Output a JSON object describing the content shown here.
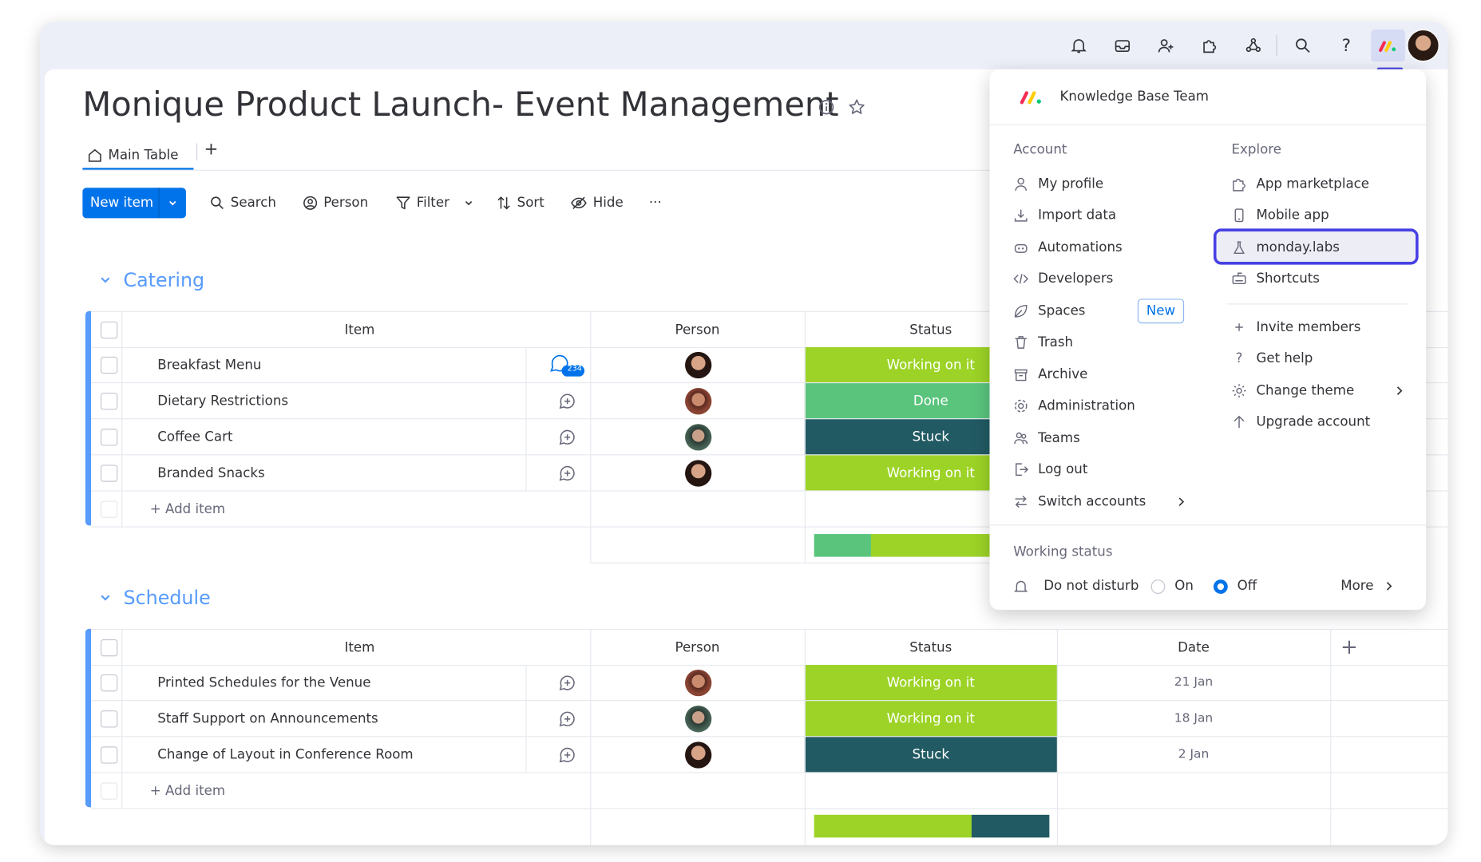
{
  "board": {
    "title": "Monique Product Launch- Event Management",
    "tabs": [
      {
        "label": "Main Table"
      }
    ],
    "add_tab": "+"
  },
  "toolbar": {
    "new_item": "New item",
    "search": "Search",
    "person": "Person",
    "filter": "Filter",
    "sort": "Sort",
    "hide": "Hide",
    "more": "···"
  },
  "columns": {
    "item": "Item",
    "person": "Person",
    "status": "Status",
    "date": "Date",
    "add": "+"
  },
  "groups": [
    {
      "name": "Catering",
      "color": "#579bfc",
      "rows": [
        {
          "item": "Breakfast Menu",
          "updates": "234",
          "status": "Working on it",
          "status_color": "#9cd326"
        },
        {
          "item": "Dietary Restrictions",
          "status": "Done",
          "status_color": "#5ac47d"
        },
        {
          "item": "Coffee Cart",
          "status": "Stuck",
          "status_color": "#225a63"
        },
        {
          "item": "Branded Snacks",
          "status": "Working on it",
          "status_color": "#9cd326"
        }
      ],
      "add_item": "+ Add item"
    },
    {
      "name": "Schedule",
      "color": "#579bfc",
      "rows": [
        {
          "item": "Printed Schedules for the Venue",
          "status": "Working on it",
          "status_color": "#9cd326",
          "date": "21 Jan"
        },
        {
          "item": "Staff Support on Announcements",
          "status": "Working on it",
          "status_color": "#9cd326",
          "date": "18 Jan"
        },
        {
          "item": "Change of Layout in Conference Room",
          "status": "Stuck",
          "status_color": "#225a63",
          "date": "2 Jan"
        }
      ],
      "add_item": "+ Add item"
    }
  ],
  "menu": {
    "account_name": "Knowledge Base Team",
    "account": {
      "title": "Account",
      "items": [
        "My profile",
        "Import data",
        "Automations",
        "Developers",
        "Spaces",
        "Trash",
        "Archive",
        "Administration",
        "Teams",
        "Log out",
        "Switch accounts"
      ],
      "new_badge": "New"
    },
    "explore": {
      "title": "Explore",
      "items": [
        "App marketplace",
        "Mobile app",
        "monday.labs",
        "Shortcuts"
      ],
      "secondary": [
        "Invite members",
        "Get help",
        "Change theme",
        "Upgrade account"
      ],
      "highlighted": "monday.labs"
    },
    "working_status": {
      "title": "Working status",
      "label": "Do not disturb",
      "on": "On",
      "off": "Off",
      "selected": "Off",
      "more": "More"
    }
  },
  "colors": {
    "primary": "#0073ea",
    "working": "#9cd326",
    "done": "#5ac47d",
    "stuck": "#225a63",
    "annotation": "#4640e3"
  }
}
